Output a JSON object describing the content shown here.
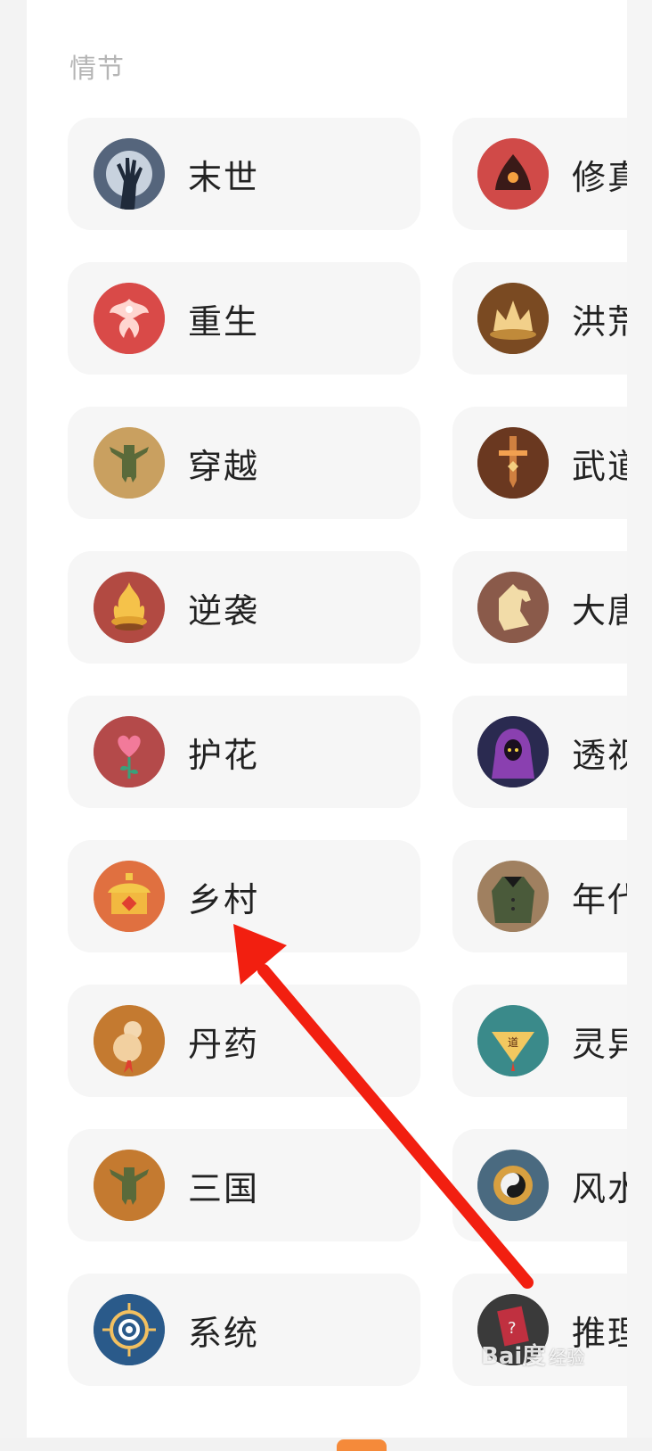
{
  "section": {
    "title": "情节"
  },
  "tags_left": [
    {
      "label": "末世",
      "icon": "zombie-hand-icon",
      "bg": "#5a6a80"
    },
    {
      "label": "重生",
      "icon": "phoenix-icon",
      "bg": "#d94a48"
    },
    {
      "label": "穿越",
      "icon": "bronze-figure-icon",
      "bg": "#c9a060"
    },
    {
      "label": "逆袭",
      "icon": "flame-icon",
      "bg": "#b24a42"
    },
    {
      "label": "护花",
      "icon": "heart-flower-icon",
      "bg": "#b44a4a"
    },
    {
      "label": "乡村",
      "icon": "yurt-icon",
      "bg": "#e07040"
    },
    {
      "label": "丹药",
      "icon": "gourd-icon",
      "bg": "#c47a30"
    },
    {
      "label": "三国",
      "icon": "bronze-figure-icon",
      "bg": "#c47a30"
    },
    {
      "label": "系统",
      "icon": "system-ring-icon",
      "bg": "#2a5a8a"
    }
  ],
  "tags_right": [
    {
      "label": "修真",
      "icon": "meditation-icon",
      "bg": "#d04a48"
    },
    {
      "label": "洪荒",
      "icon": "crown-icon",
      "bg": "#7a4a22"
    },
    {
      "label": "武道",
      "icon": "sword-icon",
      "bg": "#6a3820"
    },
    {
      "label": "大唐",
      "icon": "horse-icon",
      "bg": "#8a5a4a"
    },
    {
      "label": "透视",
      "icon": "hooded-figure-icon",
      "bg": "#2a2a50"
    },
    {
      "label": "年代",
      "icon": "coat-icon",
      "bg": "#a08060"
    },
    {
      "label": "灵异",
      "icon": "talisman-icon",
      "bg": "#3a8a8a"
    },
    {
      "label": "风水",
      "icon": "yin-yang-icon",
      "bg": "#4a6a80"
    },
    {
      "label": "推理",
      "icon": "mystery-card-icon",
      "bg": "#3a3a3a"
    }
  ],
  "colors": {
    "arrow": "#f21f10",
    "card_bg": "#f6f6f6",
    "section_title": "#b5b5b5"
  },
  "watermark": {
    "text": "Bai度",
    "sub": "经验"
  }
}
